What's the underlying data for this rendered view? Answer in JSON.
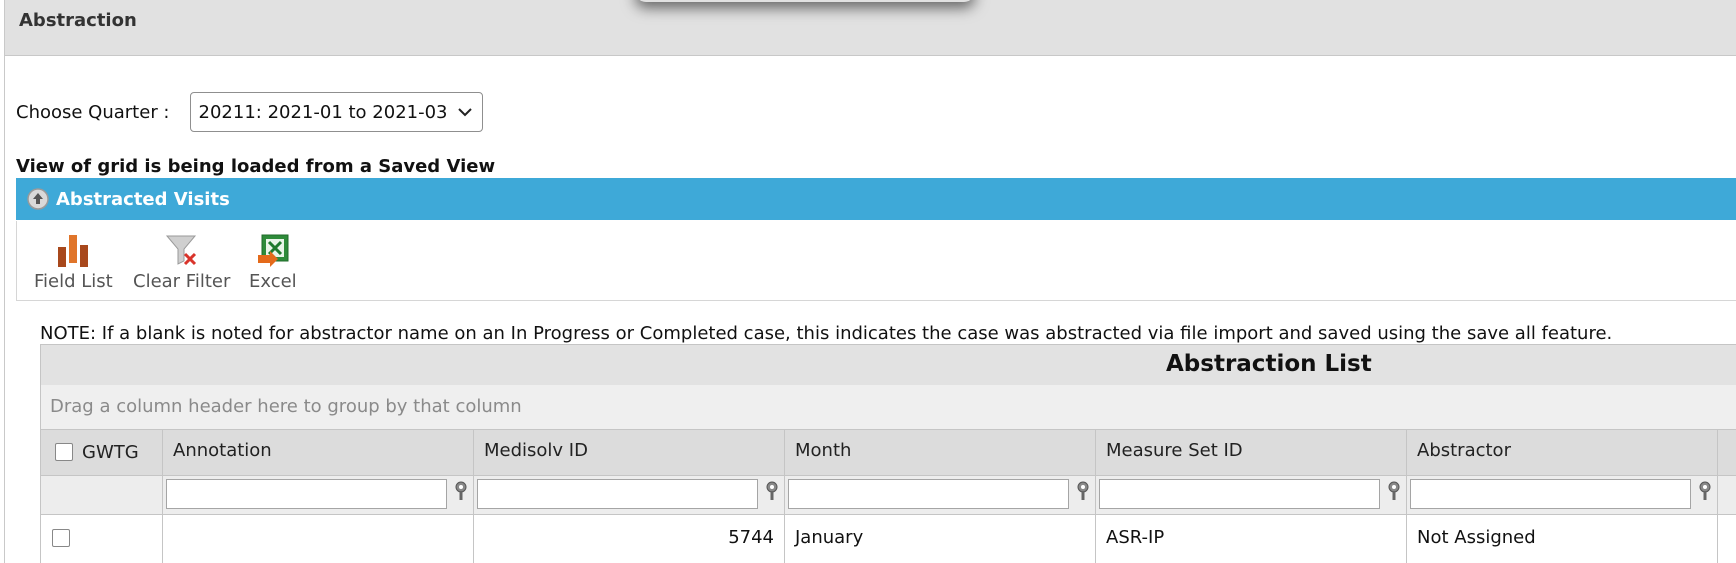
{
  "panel": {
    "title": "Abstraction"
  },
  "quarter": {
    "label": "Choose Quarter :",
    "selected": "20211: 2021-01 to 2021-03"
  },
  "saved_view_message": "View of grid is being loaded from a Saved View",
  "section": {
    "title": "Abstracted Visits"
  },
  "toolbar": {
    "field_list": "Field List",
    "clear_filter": "Clear Filter",
    "excel": "Excel"
  },
  "note": "NOTE: If a blank is noted for abstractor name on an In Progress or Completed case, this indicates the case was abstracted via file import and saved using the save all feature.",
  "grid": {
    "title": "Abstraction List",
    "group_hint": "Drag a column header here to group by that column",
    "columns": [
      "GWTG",
      "Annotation",
      "Medisolv ID",
      "Month",
      "Measure Set ID",
      "Abstractor"
    ],
    "rows": [
      {
        "annotation": "",
        "medisolv_id": "5744",
        "month": "January",
        "measure_set_id": "ASR-IP",
        "abstractor": "Not Assigned"
      }
    ]
  },
  "colors": {
    "section_bar": "#3ea9d8",
    "header_bg": "#e1e1e1",
    "grid_header": "#dcdcdc"
  }
}
